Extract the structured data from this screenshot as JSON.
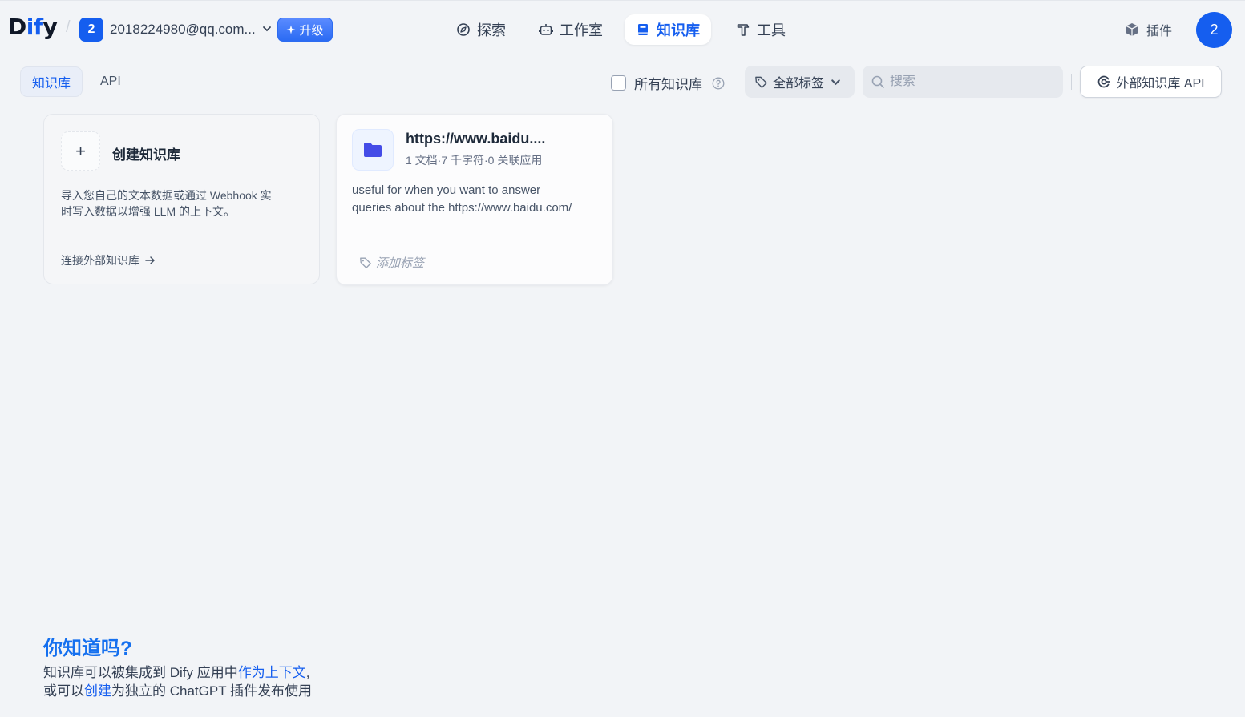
{
  "header": {
    "logo": {
      "part1": "D",
      "part2": "if",
      "part3": "y"
    },
    "separator": "/",
    "workspace": {
      "badge": "2",
      "name": "2018224980@qq.com..."
    },
    "upgrade_label": "升级",
    "nav": [
      {
        "label": "探索",
        "icon": "compass-icon",
        "active": false
      },
      {
        "label": "工作室",
        "icon": "robot-icon",
        "active": false
      },
      {
        "label": "知识库",
        "icon": "book-icon",
        "active": true
      },
      {
        "label": "工具",
        "icon": "hammer-icon",
        "active": false
      }
    ],
    "plugins_label": "插件",
    "avatar": "2"
  },
  "toolbar": {
    "tabs": [
      {
        "label": "知识库",
        "active": true
      },
      {
        "label": "API",
        "active": false
      }
    ],
    "all_kb_label": "所有知识库",
    "tag_filter_label": "全部标签",
    "search_placeholder": "搜索",
    "external_api_label": "外部知识库 API"
  },
  "create_card": {
    "title": "创建知识库",
    "desc_line1": "导入您自己的文本数据或通过 Webhook 实",
    "desc_line2": "时写入数据以增强 LLM 的上下文。",
    "connect_label": "连接外部知识库"
  },
  "knowledge_bases": [
    {
      "title": "https://www.baidu....",
      "meta": "1 文档·7 千字符·0 关联应用",
      "desc_line1": "useful for when you want to answer",
      "desc_line2": "queries about the https://www.baidu.com/",
      "tag_label": "添加标签"
    }
  ],
  "tip": {
    "title": "你知道吗?",
    "line1_pre": "知识库可以被集成到 Dify 应用中",
    "line1_link": "作为上下文",
    "line1_post": ",",
    "line2_pre": "或可以",
    "line2_link": "创建",
    "line2_post": "为独立的 ChatGPT 插件发布使用"
  },
  "colors": {
    "accent": "#155eef",
    "background": "#f2f4f7",
    "folder": "#444ce7"
  }
}
